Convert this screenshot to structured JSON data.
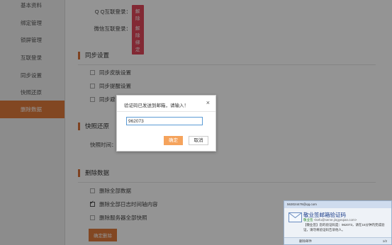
{
  "sidebar": {
    "items": [
      {
        "label": "基本资料"
      },
      {
        "label": "绑定管理"
      },
      {
        "label": "锁屏管理"
      },
      {
        "label": "互联登录"
      },
      {
        "label": "同步设置"
      },
      {
        "label": "快照还原"
      },
      {
        "label": "删除数据",
        "active": true
      }
    ]
  },
  "accounts": {
    "qq_label": "Q Q互联登录：",
    "wechat_label": "微信互联登录：",
    "unbind_label": "解除绑定"
  },
  "sync": {
    "title": "同步设置",
    "options": [
      {
        "label": "同步皮肤设置",
        "checked": false
      },
      {
        "label": "同步提醒设置",
        "checked": false
      },
      {
        "label": "同步避",
        "checked": false
      }
    ]
  },
  "snapshot": {
    "title": "快照还原",
    "time_label": "快照时间："
  },
  "delete": {
    "title": "删除数据",
    "options": [
      {
        "label": "删除全部数据",
        "checked": false
      },
      {
        "label": "删除全部日志时间轴内容",
        "checked": true
      },
      {
        "label": "删除服务器全部快照",
        "checked": false
      }
    ],
    "confirm_label": "确定删除"
  },
  "dialog": {
    "title": "验证码已发送到邮箱，请输入！",
    "close": "×",
    "input_value": "962073",
    "ok_label": "确定",
    "cancel_label": "取消"
  },
  "mail_popup": {
    "account": "563024478@qq.com",
    "subject": "敬业签邮箱验证码",
    "from_name": "敬业签",
    "from_addr": "<kefu@serve.jingyeqian.com>",
    "body": "【敬业签】您的验证码是：962073，请在15分钟内完成验证，请勿将验证码告诉他人。",
    "delete_label": "删除邮件",
    "pager": "1/2"
  },
  "colors": {
    "accent": "#e07a3b",
    "danger": "#e0475a",
    "focus": "#5b9bd5"
  }
}
